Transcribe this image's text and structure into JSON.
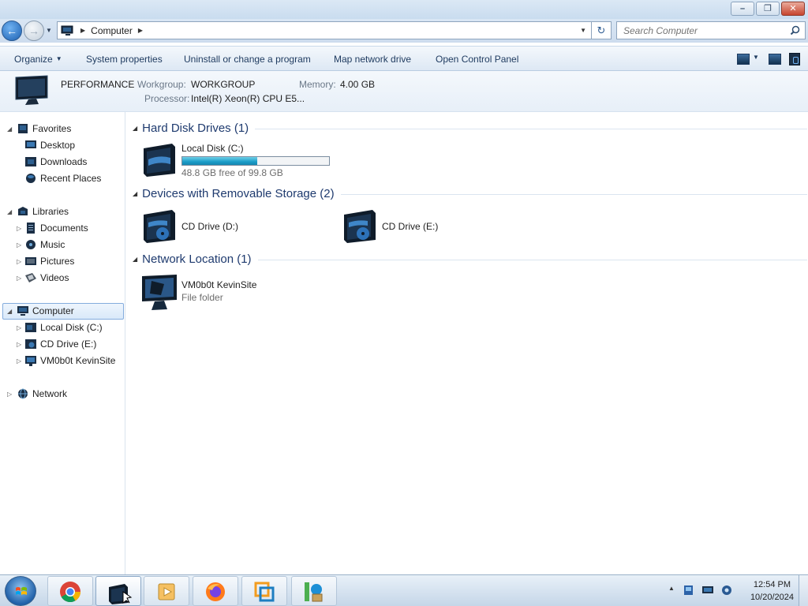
{
  "window": {
    "minimize_label": "–",
    "maximize_label": "❐",
    "close_label": "✕"
  },
  "address": {
    "breadcrumb": "Computer",
    "search_placeholder": "Search Computer"
  },
  "toolbar": {
    "organize": "Organize",
    "system_properties": "System properties",
    "uninstall": "Uninstall or change a program",
    "map_drive": "Map network drive",
    "control_panel": "Open Control Panel"
  },
  "details": {
    "computer_name": "PERFORMANCE",
    "workgroup_label": "Workgroup:",
    "workgroup_value": "WORKGROUP",
    "memory_label": "Memory:",
    "memory_value": "4.00 GB",
    "processor_label": "Processor:",
    "processor_value": "Intel(R) Xeon(R) CPU E5..."
  },
  "nav": {
    "favorites": "Favorites",
    "desktop": "Desktop",
    "downloads": "Downloads",
    "recent_places": "Recent Places",
    "libraries": "Libraries",
    "documents": "Documents",
    "music": "Music",
    "pictures": "Pictures",
    "videos": "Videos",
    "computer": "Computer",
    "local_disk": "Local Disk (C:)",
    "cd_drive_e": "CD Drive (E:)",
    "vm_site": "VM0b0t KevinSite",
    "network": "Network"
  },
  "content": {
    "hdd_group": "Hard Disk Drives (1)",
    "removable_group": "Devices with Removable Storage (2)",
    "network_group": "Network Location (1)",
    "local_disk_name": "Local Disk (C:)",
    "local_disk_free": "48.8 GB free of 99.8 GB",
    "local_disk_used_fraction": 0.511,
    "cd_d_name": "CD Drive (D:)",
    "cd_e_name": "CD Drive (E:)",
    "network_item_name": "VM0b0t KevinSite",
    "network_item_type": "File folder"
  },
  "taskbar": {
    "time": "12:54 PM",
    "date": "10/20/2024"
  },
  "colors": {
    "accent": "#1e3a6e",
    "selection_border": "#84acdd",
    "progress_fill": "#1b9cc8"
  }
}
